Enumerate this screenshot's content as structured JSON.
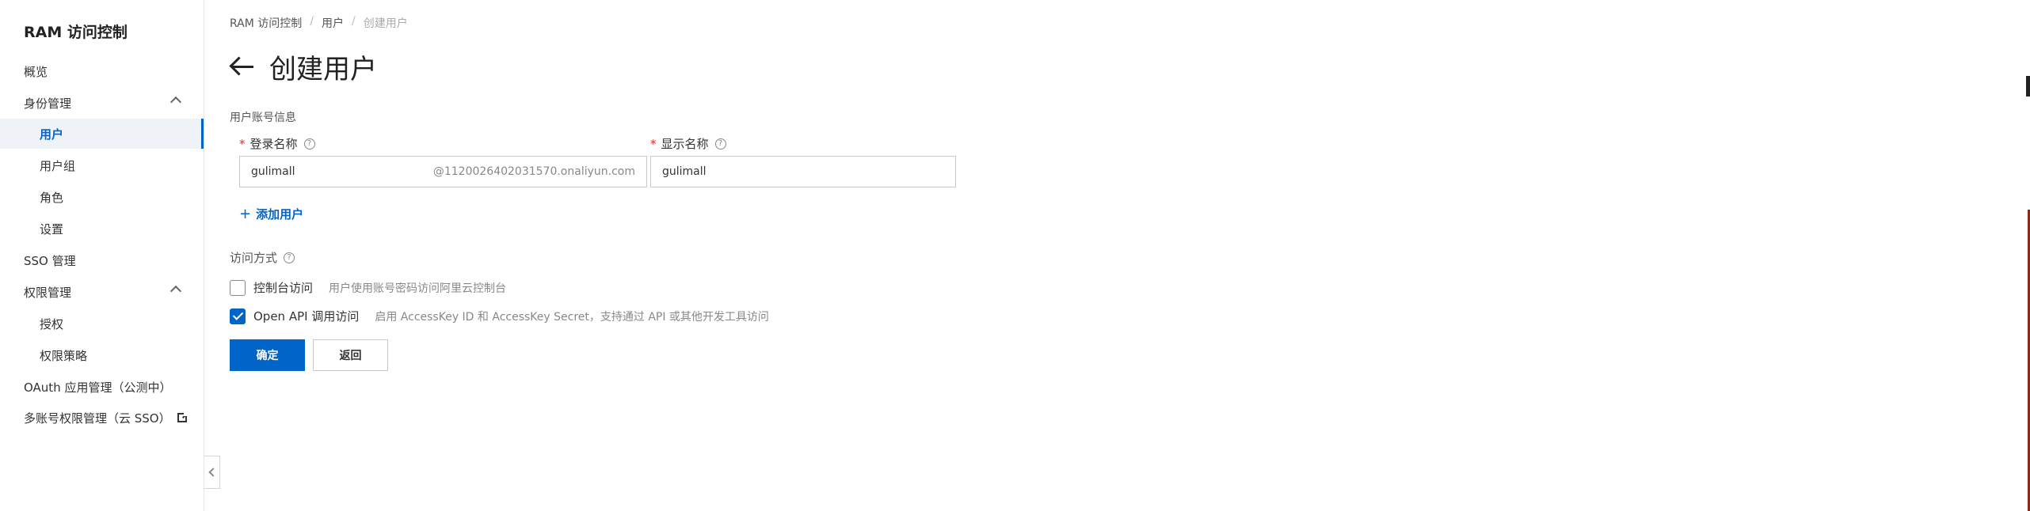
{
  "sidebar": {
    "title": "RAM 访问控制",
    "items": [
      {
        "label": "概览"
      },
      {
        "label": "身份管理"
      },
      {
        "label": "用户"
      },
      {
        "label": "用户组"
      },
      {
        "label": "角色"
      },
      {
        "label": "设置"
      },
      {
        "label": "SSO 管理"
      },
      {
        "label": "权限管理"
      },
      {
        "label": "授权"
      },
      {
        "label": "权限策略"
      },
      {
        "label": "OAuth 应用管理（公测中）"
      },
      {
        "label": "多账号权限管理（云 SSO）"
      }
    ]
  },
  "breadcrumb": [
    "RAM 访问控制",
    "用户",
    "创建用户"
  ],
  "page": {
    "title": "创建用户",
    "section": "用户账号信息",
    "login_name_label": "登录名称",
    "display_name_label": "显示名称",
    "login_name_value": "gulimall",
    "login_name_suffix": "@1120026402031570.onaliyun.com",
    "display_name_value": "gulimall",
    "add_user": "添加用户",
    "access_label": "访问方式",
    "console_access": {
      "label": "控制台访问",
      "desc": "用户使用账号密码访问阿里云控制台",
      "checked": false
    },
    "api_access": {
      "label": "Open API 调用访问",
      "desc": "启用 AccessKey ID 和 AccessKey Secret，支持通过 API 或其他开发工具访问",
      "checked": true
    },
    "confirm": "确定",
    "back": "返回"
  },
  "colors": {
    "accent": "#0064c8",
    "required": "#d93026"
  }
}
